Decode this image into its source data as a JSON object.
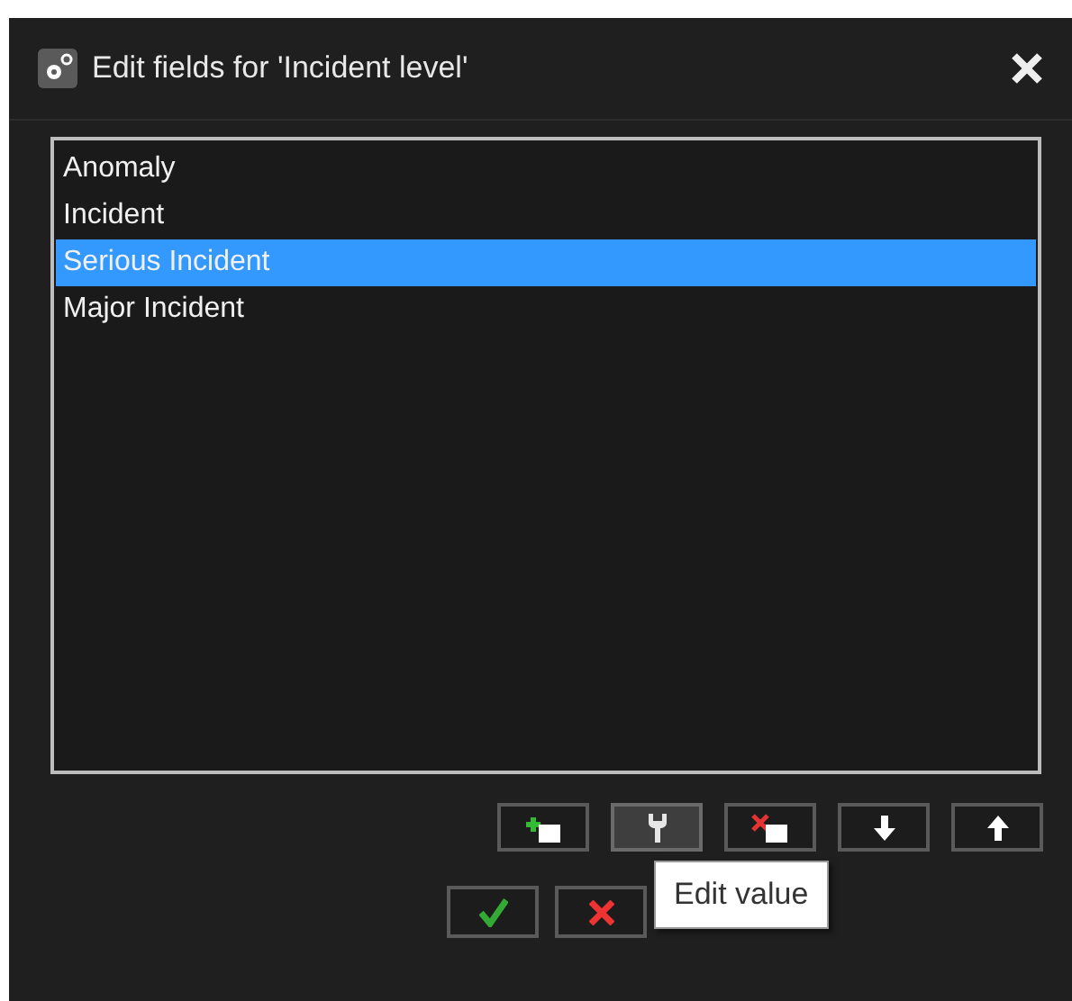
{
  "window": {
    "title": "Edit fields for 'Incident level'"
  },
  "list": {
    "items": [
      {
        "label": "Anomaly",
        "selected": false
      },
      {
        "label": "Incident",
        "selected": false
      },
      {
        "label": "Serious Incident",
        "selected": true
      },
      {
        "label": "Major Incident",
        "selected": false
      }
    ]
  },
  "toolbar": [
    {
      "kind": "add",
      "hovered": false
    },
    {
      "kind": "edit",
      "hovered": true
    },
    {
      "kind": "delete",
      "hovered": false
    },
    {
      "kind": "down",
      "hovered": false
    },
    {
      "kind": "up",
      "hovered": false
    }
  ],
  "actions": [
    {
      "kind": "ok"
    },
    {
      "kind": "cancel"
    }
  ],
  "tooltip": {
    "text": "Edit value"
  }
}
